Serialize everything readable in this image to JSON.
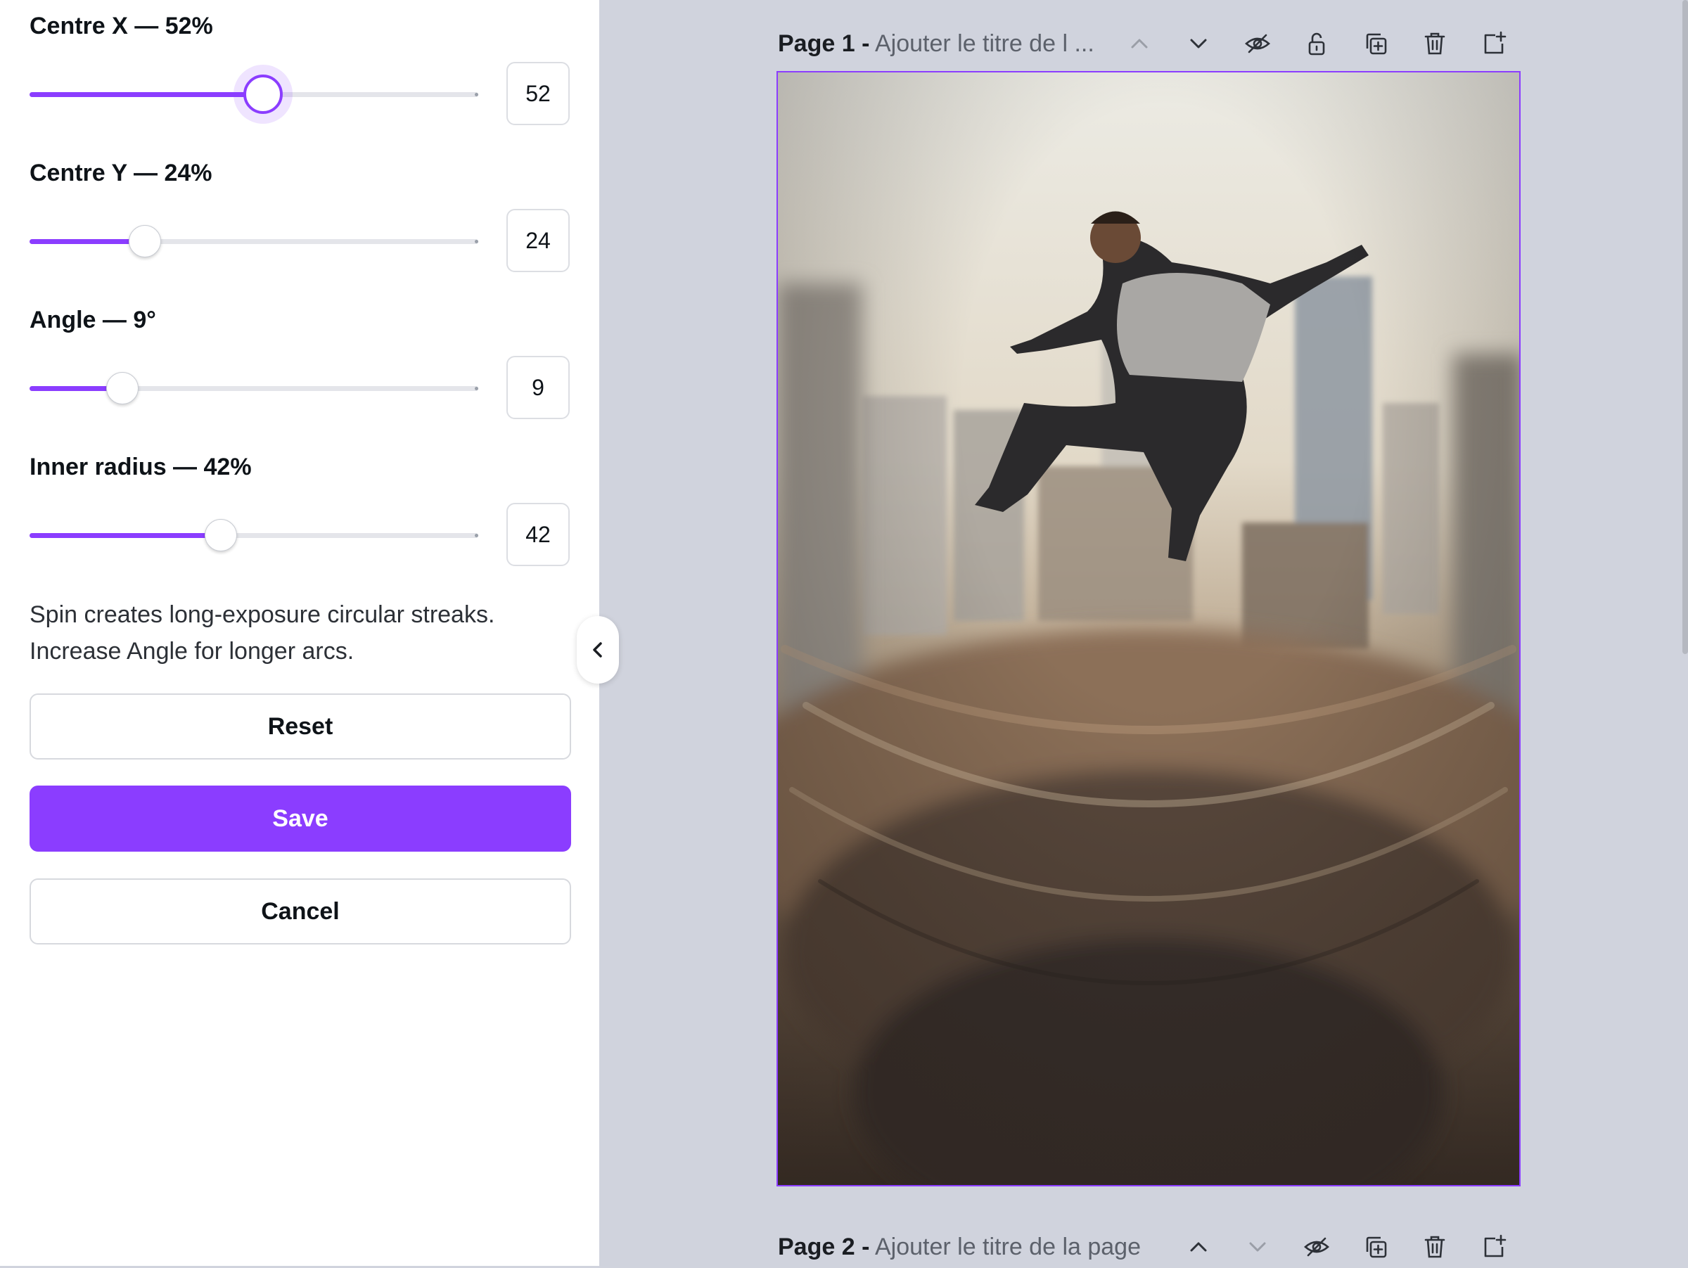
{
  "panel": {
    "controls": [
      {
        "label": "Centre X — 52%",
        "value": "52",
        "fraction": 0.52,
        "active": true
      },
      {
        "label": "Centre Y — 24%",
        "value": "24",
        "fraction": 0.24,
        "active": false
      },
      {
        "label": "Angle — 9°",
        "value": "9",
        "fraction": 0.21,
        "active": false
      },
      {
        "label": "Inner radius — 42%",
        "value": "42",
        "fraction": 0.42,
        "active": false
      }
    ],
    "help_line1": "Spin creates long-exposure circular streaks.",
    "help_line2": "Increase Angle for longer arcs.",
    "reset_label": "Reset",
    "save_label": "Save",
    "cancel_label": "Cancel"
  },
  "pages": [
    {
      "number": "Page 1 -",
      "title": "Ajouter le titre de l ..."
    },
    {
      "number": "Page 2 -",
      "title": "Ajouter le titre de la page"
    }
  ],
  "colors": {
    "accent": "#8b3dff",
    "canvas_bg": "#d0d3dd"
  }
}
